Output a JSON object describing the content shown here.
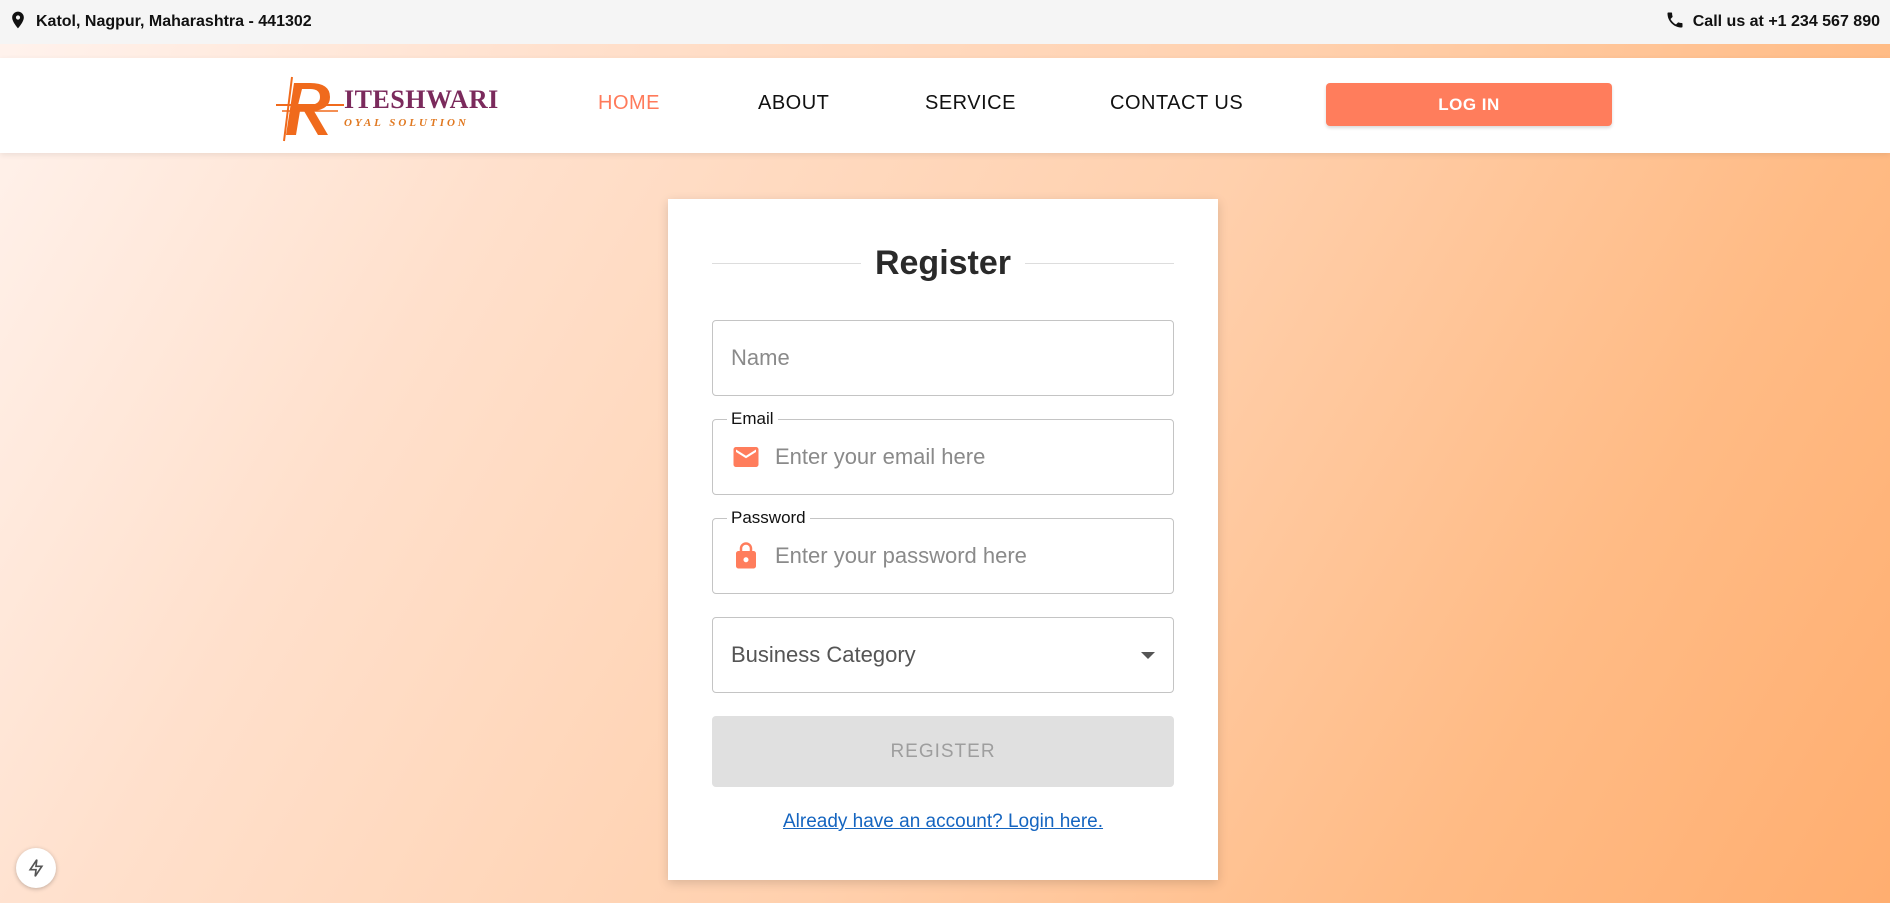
{
  "topbar": {
    "address": "Katol, Nagpur, Maharashtra - 441302",
    "phone": "Call us at +1 234 567 890"
  },
  "logo": {
    "word": "ITESHWARI",
    "tagline": "OYAL SOLUTION"
  },
  "nav": {
    "items": [
      {
        "label": "HOME",
        "active": true
      },
      {
        "label": "ABOUT",
        "active": false
      },
      {
        "label": "SERVICE",
        "active": false
      },
      {
        "label": "CONTACT US",
        "active": false
      }
    ],
    "login_label": "LOG IN"
  },
  "form": {
    "title": "Register",
    "name_placeholder": "Name",
    "email_label": "Email",
    "email_placeholder": "Enter your email here",
    "password_label": "Password",
    "password_placeholder": "Enter your password here",
    "category_placeholder": "Business Category",
    "register_label": "REGISTER",
    "login_link": "Already have an account? Login here."
  },
  "colors": {
    "accent": "#ff7d5c",
    "link": "#1565c0"
  }
}
